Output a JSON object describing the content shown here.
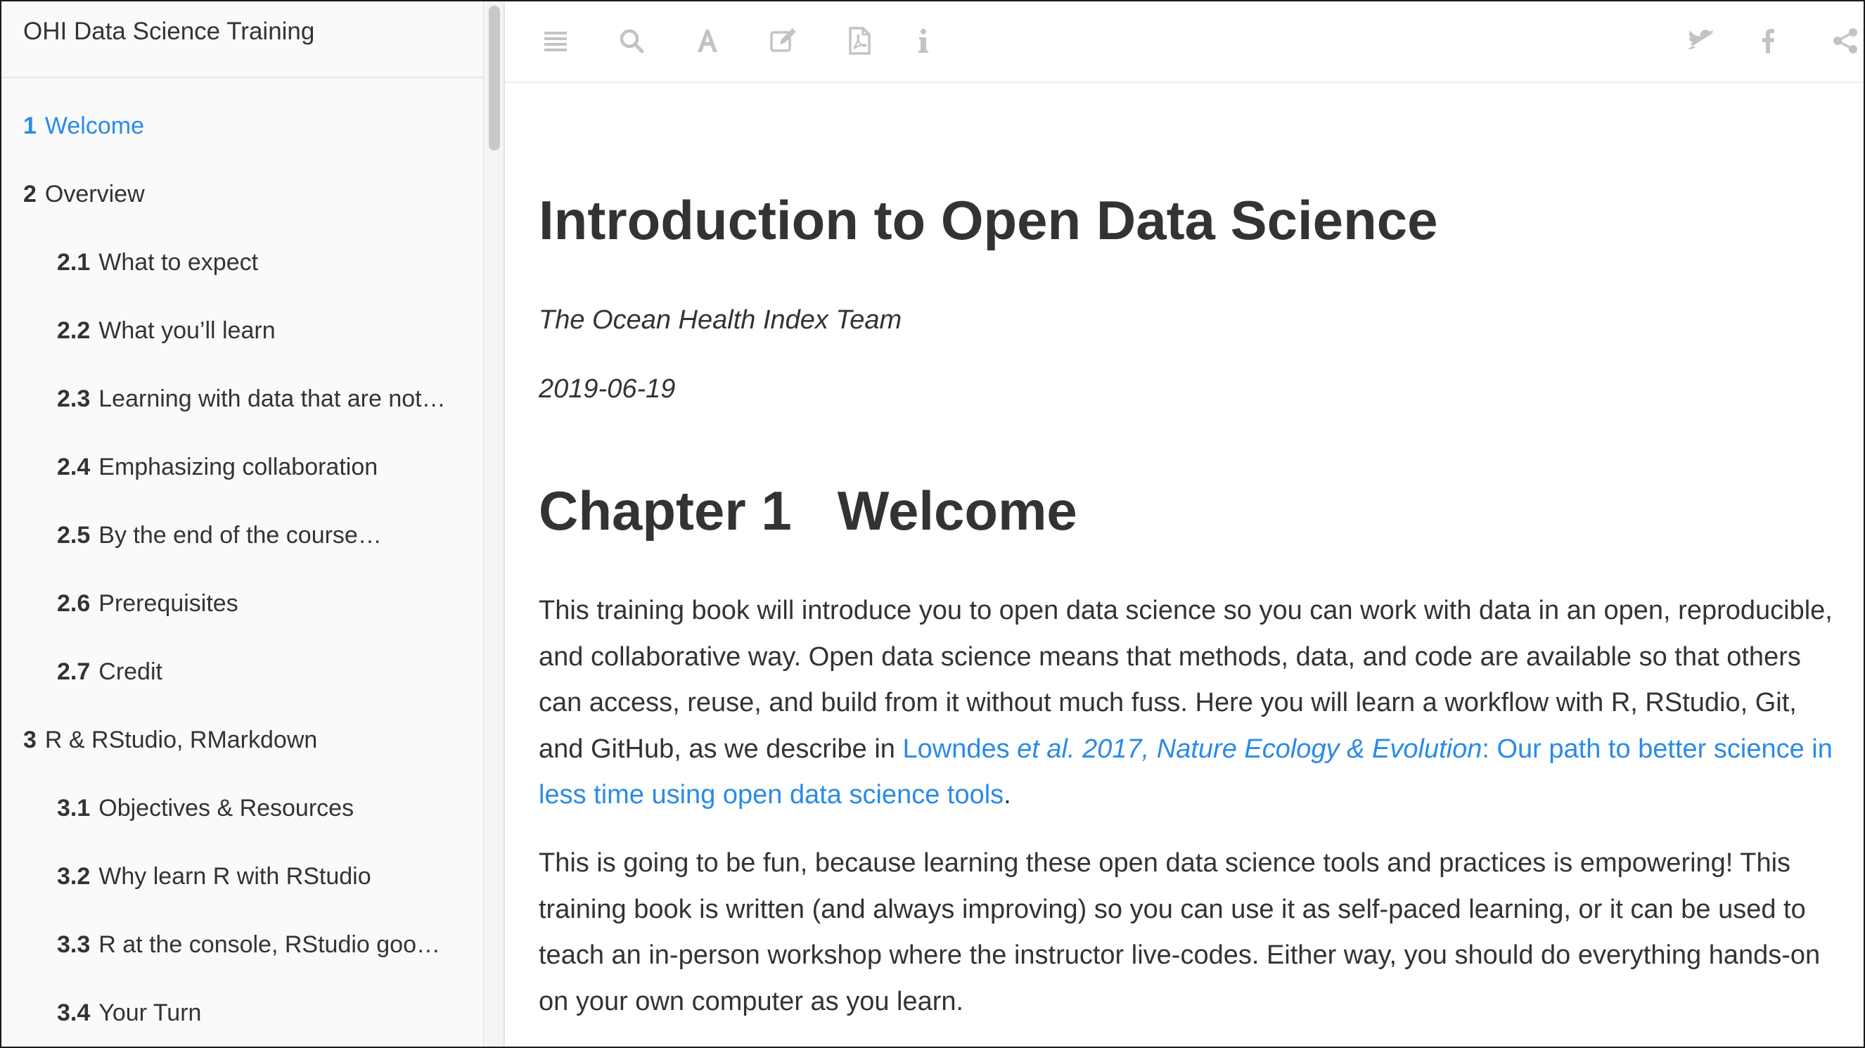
{
  "sidebar": {
    "book_title": "OHI Data Science Training",
    "items": [
      {
        "num": "1",
        "label": "Welcome",
        "level": 1,
        "active": true
      },
      {
        "num": "2",
        "label": "Overview",
        "level": 1
      },
      {
        "num": "2.1",
        "label": "What to expect",
        "level": 2
      },
      {
        "num": "2.2",
        "label": "What you’ll learn",
        "level": 2
      },
      {
        "num": "2.3",
        "label": "Learning with data that are not…",
        "level": 2
      },
      {
        "num": "2.4",
        "label": "Emphasizing collaboration",
        "level": 2
      },
      {
        "num": "2.5",
        "label": "By the end of the course…",
        "level": 2
      },
      {
        "num": "2.6",
        "label": "Prerequisites",
        "level": 2
      },
      {
        "num": "2.7",
        "label": "Credit",
        "level": 2
      },
      {
        "num": "3",
        "label": "R & RStudio, RMarkdown",
        "level": 1
      },
      {
        "num": "3.1",
        "label": "Objectives & Resources",
        "level": 2
      },
      {
        "num": "3.2",
        "label": "Why learn R with RStudio",
        "level": 2
      },
      {
        "num": "3.3",
        "label": "R at the console, RStudio goo…",
        "level": 2
      },
      {
        "num": "3.4",
        "label": "Your Turn",
        "level": 2
      }
    ]
  },
  "toolbar": {
    "left_icons": [
      "menu-icon",
      "search-icon",
      "font-icon",
      "edit-icon",
      "pdf-icon",
      "info-icon"
    ],
    "right_icons": [
      "twitter-icon",
      "facebook-icon",
      "share-icon"
    ],
    "icon_color": "#c3c3c3"
  },
  "content": {
    "title": "Introduction to Open Data Science",
    "author": "The Ocean Health Index Team",
    "date": "2019-06-19",
    "chapter_num": "Chapter 1",
    "chapter_title": "Welcome",
    "para1_text": "This training book will introduce you to open data science so you can work with data in an open, reproducible, and collaborative way. Open data science means that methods, data, and code are available so that others can access, reuse, and build from it without much fuss. Here you will learn a workflow with R, RStudio, Git, and GitHub, as we describe in ",
    "para1_link_a": "Lowndes ",
    "para1_link_b": "et al.",
    "para1_link_c": " 2017, Nature Ecology & Evolution",
    "para1_link_d": ": Our path to better science in less time using open data science tools",
    "para1_end": ".",
    "para2_text": "This is going to be fun, because learning these open data science tools and practices is empowering! This training book is written (and always improving) so you can use it as self-paced learning, or it can be used to teach an in-person workshop where the instructor live-codes. Either way, you should do everything hands-on on your own computer as you learn."
  },
  "colors": {
    "link": "#2a8be6",
    "active_toc": "#2a8be6",
    "text": "#333333",
    "sidebar_bg": "#fafafa"
  }
}
